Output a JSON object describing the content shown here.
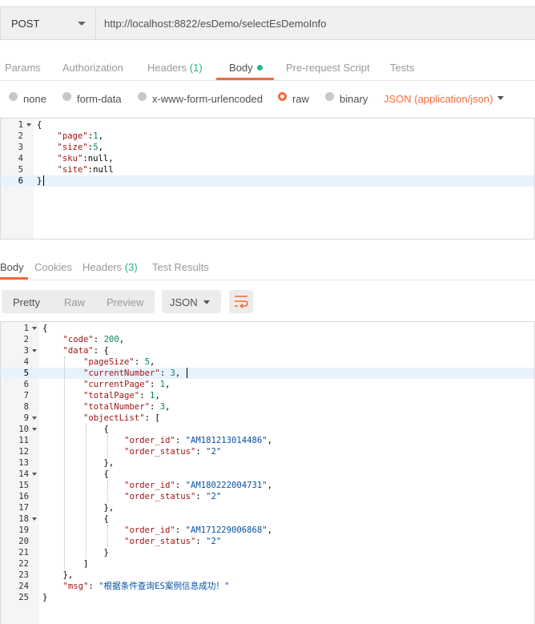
{
  "request": {
    "method": "POST",
    "url": "http://localhost:8822/esDemo/selectEsDemoInfo"
  },
  "request_tabs": {
    "params": "Params",
    "authorization": "Authorization",
    "headers": "Headers",
    "headers_count": "(1)",
    "body": "Body",
    "prerequest": "Pre-request Script",
    "tests": "Tests"
  },
  "body_types": {
    "none": "none",
    "form_data": "form-data",
    "urlencoded": "x-www-form-urlencoded",
    "raw": "raw",
    "binary": "binary",
    "format": "JSON (application/json)",
    "selected": "raw"
  },
  "request_body": {
    "lines": [
      {
        "n": "1",
        "text": "{"
      },
      {
        "n": "2",
        "text": "    \"page\":1,"
      },
      {
        "n": "3",
        "text": "    \"size\":5,"
      },
      {
        "n": "4",
        "text": "    \"sku\":null,"
      },
      {
        "n": "5",
        "text": "    \"site\":null"
      },
      {
        "n": "6",
        "text": "}"
      }
    ]
  },
  "response_tabs": {
    "body": "Body",
    "cookies": "Cookies",
    "headers": "Headers",
    "headers_count": "(3)",
    "test_results": "Test Results"
  },
  "response_toolbar": {
    "pretty": "Pretty",
    "raw": "Raw",
    "preview": "Preview",
    "format": "JSON"
  },
  "response_body": {
    "lines": [
      {
        "n": "1",
        "text": "{"
      },
      {
        "n": "2",
        "text": "    \"code\": 200,"
      },
      {
        "n": "3",
        "text": "    \"data\": {"
      },
      {
        "n": "4",
        "text": "        \"pageSize\": 5,"
      },
      {
        "n": "5",
        "text": "        \"currentNumber\": 3,"
      },
      {
        "n": "6",
        "text": "        \"currentPage\": 1,"
      },
      {
        "n": "7",
        "text": "        \"totalPage\": 1,"
      },
      {
        "n": "8",
        "text": "        \"totalNumber\": 3,"
      },
      {
        "n": "9",
        "text": "        \"objectList\": ["
      },
      {
        "n": "10",
        "text": "            {"
      },
      {
        "n": "11",
        "text": "                \"order_id\": \"AM181213014486\","
      },
      {
        "n": "12",
        "text": "                \"order_status\": \"2\""
      },
      {
        "n": "13",
        "text": "            },"
      },
      {
        "n": "14",
        "text": "            {"
      },
      {
        "n": "15",
        "text": "                \"order_id\": \"AM180222004731\","
      },
      {
        "n": "16",
        "text": "                \"order_status\": \"2\""
      },
      {
        "n": "17",
        "text": "            },"
      },
      {
        "n": "18",
        "text": "            {"
      },
      {
        "n": "19",
        "text": "                \"order_id\": \"AM171229006868\","
      },
      {
        "n": "20",
        "text": "                \"order_status\": \"2\""
      },
      {
        "n": "21",
        "text": "            }"
      },
      {
        "n": "22",
        "text": "        ]"
      },
      {
        "n": "23",
        "text": "    },"
      },
      {
        "n": "24",
        "text": "    \"msg\": \"根据条件查询ES案例信息成功！\""
      },
      {
        "n": "25",
        "text": "}"
      }
    ]
  },
  "icons": {
    "method_dropdown": "chevron-down-icon",
    "format_dropdown": "chevron-down-icon",
    "wrap": "wrap-lines-icon",
    "fold": "fold-arrow-icon"
  },
  "colors": {
    "accent": "#f26b3a",
    "count": "#26b47f"
  }
}
